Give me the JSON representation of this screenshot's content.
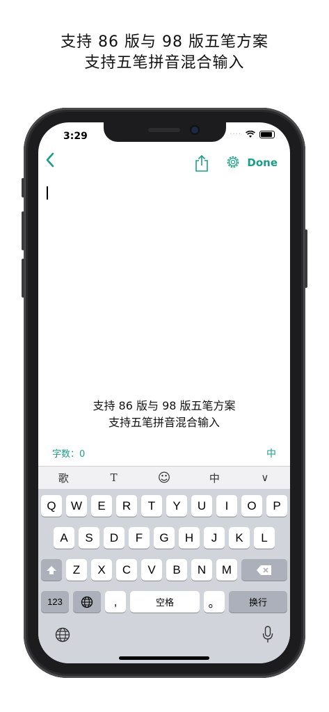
{
  "headline": {
    "line1": "支持 86 版与 98 版五笔方案",
    "line2": "支持五笔拼音混合输入"
  },
  "status_bar": {
    "time": "3:29",
    "signal": "····"
  },
  "navbar": {
    "done_label": "Done"
  },
  "editor": {
    "text_line1": "支持 86 版与 98 版五笔方案",
    "text_line2": "支持五笔拼音混合输入",
    "word_count": "字数：0",
    "input_mode": "中"
  },
  "toolbar": {
    "items": [
      "歌",
      "T",
      "☺",
      "中",
      "∨"
    ]
  },
  "keyboard": {
    "row1": [
      "Q",
      "W",
      "E",
      "R",
      "T",
      "Y",
      "U",
      "I",
      "O",
      "P"
    ],
    "row2": [
      "A",
      "S",
      "D",
      "F",
      "G",
      "H",
      "J",
      "K",
      "L"
    ],
    "row3": [
      "Z",
      "X",
      "C",
      "V",
      "B",
      "N",
      "M"
    ],
    "numbers_label": "123",
    "comma_label": ",",
    "space_label": "空格",
    "period_label": "。",
    "return_label": "换行"
  },
  "colors": {
    "accent": "#1a9e87",
    "keyboard_bg": "#d1d4da"
  }
}
